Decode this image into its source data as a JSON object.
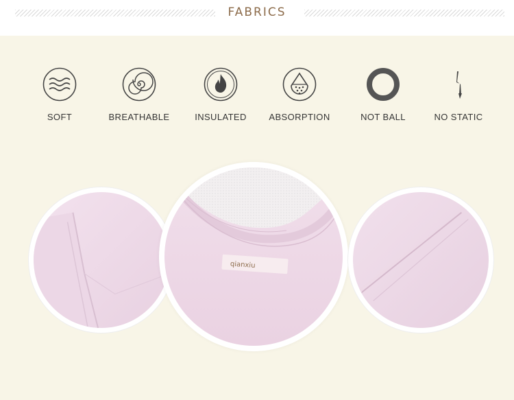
{
  "header": {
    "title": "FABRICS"
  },
  "features": [
    {
      "icon": "waves-icon",
      "label": "SOFT"
    },
    {
      "icon": "spiral-icon",
      "label": "BREATHABLE"
    },
    {
      "icon": "flame-icon",
      "label": "INSULATED"
    },
    {
      "icon": "water-drop-icon",
      "label": "ABSORPTION"
    },
    {
      "icon": "ring-icon",
      "label": "NOT BALL"
    },
    {
      "icon": "lightning-icon",
      "label": "NO STATIC"
    }
  ],
  "photos": {
    "center_label_text": "qianxiu",
    "colors": {
      "fabric": "#efdbe8",
      "fabric_shade": "#e4cbdc",
      "accent": "#8c6b4a",
      "icon_dark": "#444444"
    }
  }
}
